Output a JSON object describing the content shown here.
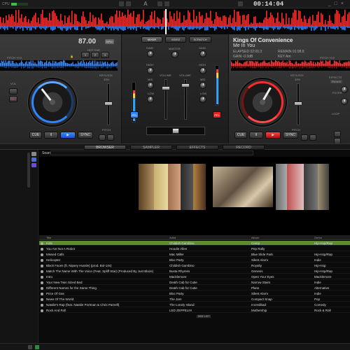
{
  "topbar": {
    "cpu_label": "CPU",
    "cpu_load": 0.35,
    "logo": "A",
    "clock": "00:14:04",
    "window_buttons": [
      "_",
      "□",
      "×"
    ]
  },
  "colors": {
    "deck_left": "#2f86ff",
    "deck_right": "#ff2a2a",
    "selected_row": "#5e8a32"
  },
  "left_deck": {
    "bpm": "87.00",
    "bpm_tag": "BPM",
    "hot_cue": "HOT CUE",
    "hot_cue_buttons": [
      "1",
      "2",
      "3"
    ],
    "pitch_text": "PITCH +0.0",
    "keylock": "KEYLOCK",
    "keylock_value": "33%",
    "pitch_label": "PITCH",
    "vol_label": "VOL",
    "rec_label": "REC",
    "transport": {
      "cue": "CUE",
      "pause": "II",
      "play": "▶",
      "sync": "SYNC"
    }
  },
  "right_deck": {
    "title": "Kings Of Convenience",
    "subtitle": "Me In You",
    "elapsed": "ELAPSED 02:00.3",
    "remain": "REMAIN 01:08.8",
    "gain": "GAIN -0.0dB",
    "key": "KEY Am",
    "pitch_text": "PITCH +0.0",
    "keylock": "KEYLOCK",
    "keylock_value": "33%",
    "pitch_label": "PITCH",
    "effects_label": "EFFECTS",
    "effects_value": "Reverb",
    "filter_label": "FILTER",
    "loop_label": "LOOP",
    "transport": {
      "cue": "CUE",
      "pause": "II",
      "play": "▶",
      "sync": "SYNC"
    }
  },
  "mixer": {
    "tabs": [
      "MIXER",
      "VIDEO",
      "SCRATCH"
    ],
    "active_tab": "MIXER",
    "master": "MASTER",
    "knob_labels_left": [
      "GAIN",
      "HIGH",
      "MID",
      "LOW"
    ],
    "knob_labels_right": [
      "GAIN",
      "HIGH",
      "MID",
      "LOW"
    ],
    "volume_label": "VOLUME",
    "pfl": "PFL"
  },
  "tabs": [
    "BROWSER",
    "SAMPLER",
    "EFFECTS",
    "RECORD"
  ],
  "active_tab": "BROWSER",
  "browser": {
    "search_label": "Search:",
    "columns": [
      "Title",
      "Artist",
      "Album",
      "Genre"
    ],
    "rows": [
      {
        "title": "Kids",
        "artist": "Childish Gambino",
        "album": "Camp",
        "genre": "Hip-Hop/Rap"
      },
      {
        "title": "You Are Not A Robot",
        "artist": "Hoodie Allen",
        "album": "Pep Rally",
        "genre": ""
      },
      {
        "title": "Missed Calls",
        "artist": "Mac Miller",
        "album": "Blue Slide Park",
        "genre": "Hip-Hop/Rap"
      },
      {
        "title": "Helicopter",
        "artist": "Bloc Party",
        "album": "Silent Alarm",
        "genre": "Indie"
      },
      {
        "title": "Black Faces (ft. Nipsey Hussle) (prod. Bol-14s)",
        "artist": "Childish Gambino",
        "album": "Royalty",
        "genre": "Hip-Hop"
      },
      {
        "title": "Match The Name With The Voice (Feat. Spliff Star) (Produced By Just Blaze)",
        "artist": "Busta Rhymes",
        "album": "Genesis",
        "genre": "Hip-Hop/Rap"
      },
      {
        "title": "Intro",
        "artist": "Macklemore",
        "album": "Open Your Eyes",
        "genre": "Macklemore"
      },
      {
        "title": "Your New Twin Sized Bed",
        "artist": "Death Cab for Cutie",
        "album": "Narrow Stairs",
        "genre": "Indie"
      },
      {
        "title": "Different Names for the Same Thing",
        "artist": "Death Cab for Cutie",
        "album": "Plans",
        "genre": "Alternative"
      },
      {
        "title": "Price Of Gas",
        "artist": "Bloc Party",
        "album": "Silent Alarm",
        "genre": "Indie"
      },
      {
        "title": "News Of The World",
        "artist": "The Jam",
        "album": "Compact Snap",
        "genre": "Pop"
      },
      {
        "title": "Natalie's Rap (feat. Natalie Portman & Chris Parnell)",
        "artist": "The Lonely Island",
        "album": "Incredibad",
        "genre": "Comedy"
      },
      {
        "title": "Rock And Roll",
        "artist": "LED ZEPPELIN",
        "album": "Mothership",
        "genre": "Rock & Roll"
      }
    ],
    "side_list": "SIDE LIST"
  }
}
